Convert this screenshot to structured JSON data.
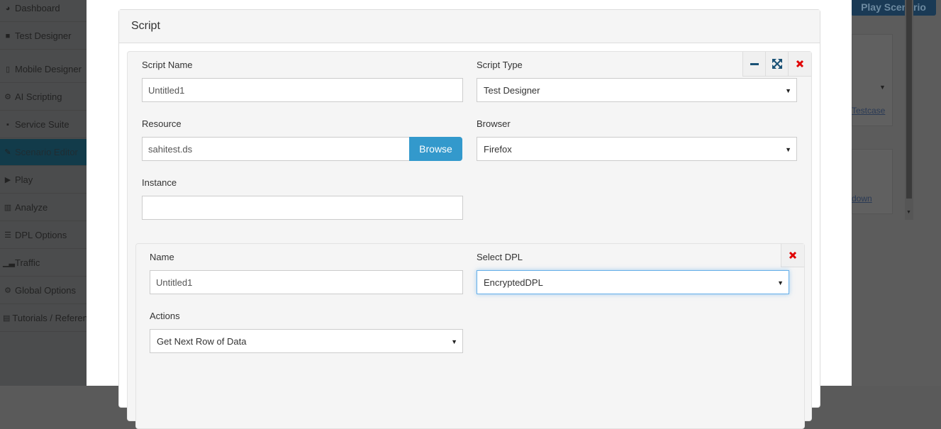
{
  "sidebar": {
    "items": [
      {
        "label": "Dashboard",
        "icon": "dashboard-icon"
      },
      {
        "label": "Test Designer",
        "icon": "video-camera-icon"
      },
      {
        "label": "Mobile Designer",
        "icon": "mobile-icon"
      },
      {
        "label": "AI Scripting",
        "icon": "cogs-icon"
      },
      {
        "label": "Service Suite",
        "icon": "briefcase-icon"
      },
      {
        "label": "Scenario Editor",
        "icon": "wrench-icon"
      },
      {
        "label": "Play",
        "icon": "play-icon"
      },
      {
        "label": "Analyze",
        "icon": "bar-chart-icon"
      },
      {
        "label": "DPL Options",
        "icon": "list-icon"
      },
      {
        "label": "Traffic",
        "icon": "signal-icon"
      },
      {
        "label": "Global Options",
        "icon": "gears-icon"
      },
      {
        "label": "Tutorials / Referen",
        "icon": "book-icon"
      }
    ],
    "active_index": 5
  },
  "background": {
    "play_button": "Play Scenario",
    "link_testcase": "Testcase",
    "link_down": "down"
  },
  "panel": {
    "title": "Script"
  },
  "script": {
    "name_label": "Script Name",
    "name_value": "Untitled1",
    "type_label": "Script Type",
    "type_value": "Test Designer",
    "resource_label": "Resource",
    "resource_value": "sahitest.ds",
    "browse_label": "Browse",
    "browser_label": "Browser",
    "browser_value": "Firefox",
    "instance_label": "Instance",
    "instance_value": ""
  },
  "dpl": {
    "name_label": "Name",
    "name_value": "Untitled1",
    "select_label": "Select DPL",
    "select_value": "EncryptedDPL",
    "actions_label": "Actions",
    "actions_value": "Get Next Row of Data"
  },
  "colors": {
    "accent": "#3399cc",
    "close_red": "#e00000",
    "toolbar_blue": "#1a5276"
  }
}
